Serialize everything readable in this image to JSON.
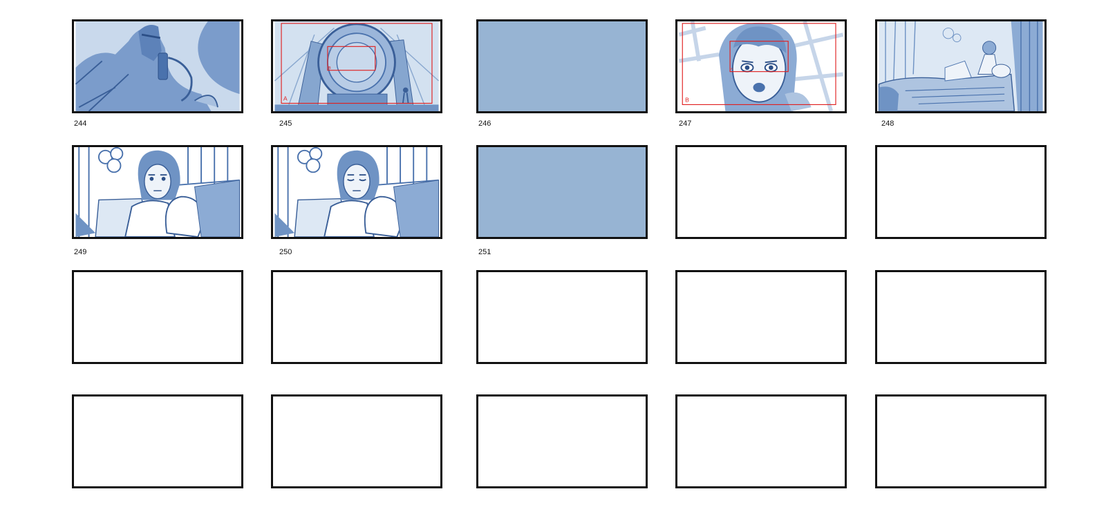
{
  "panels": [
    {
      "number": "244",
      "content": "sketch"
    },
    {
      "number": "245",
      "content": "sketch",
      "frame_labels": [
        "A",
        "B"
      ]
    },
    {
      "number": "246",
      "content": "fill"
    },
    {
      "number": "247",
      "content": "sketch",
      "frame_labels": [
        "B",
        "A"
      ]
    },
    {
      "number": "248",
      "content": "sketch"
    },
    {
      "number": "249",
      "content": "sketch"
    },
    {
      "number": "250",
      "content": "sketch"
    },
    {
      "number": "251",
      "content": "fill"
    }
  ],
  "colors": {
    "sketch_blue": "#4a72ad",
    "fill_blue": "#97b4d3",
    "light_blue": "#cbdcee",
    "frame_red": "#e02020",
    "border": "#111111"
  }
}
